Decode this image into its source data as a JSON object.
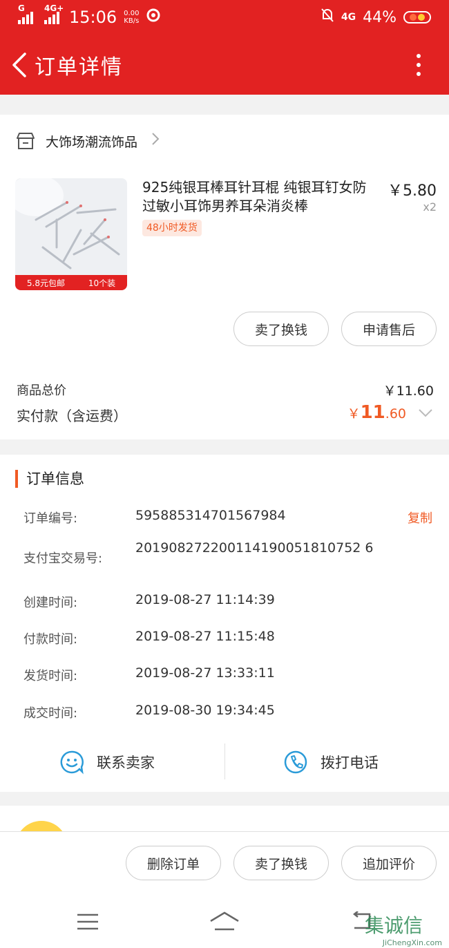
{
  "status_bar": {
    "signal1": "G",
    "signal2": "4G+",
    "time": "15:06",
    "speed_value": "0.00",
    "speed_unit": "KB/s",
    "net_right": "4G",
    "battery": "44%"
  },
  "header": {
    "title": "订单详情",
    "back_icon": "chevron-left-icon",
    "menu_icon": "more-vertical-icon"
  },
  "shop": {
    "name": "大饰场潮流饰品",
    "icon": "store-icon"
  },
  "product": {
    "title": "925纯银耳棒耳针耳棍 纯银耳钉女防过敏小耳饰男养耳朵消炎棒",
    "tag": "48小时发货",
    "price": "￥5.80",
    "quantity": "x2",
    "thumb_badge_left": "5.8元包邮",
    "thumb_badge_right": "10个装"
  },
  "item_actions": {
    "sell_label": "卖了换钱",
    "after_sale_label": "申请售后"
  },
  "totals": {
    "goods_total_label": "商品总价",
    "goods_total_value": "￥11.60",
    "paid_label": "实付款（含运费）",
    "paid_currency": "￥",
    "paid_integer": "11",
    "paid_decimal": ".60"
  },
  "order_info": {
    "section_title": "订单信息",
    "copy_label": "复制",
    "rows": [
      {
        "label": "订单编号:",
        "value": "595885314701567984"
      },
      {
        "label": "支付宝交易号:",
        "value": "201908272200114190051810752 6"
      },
      {
        "label": "创建时间:",
        "value": "2019-08-27 11:14:39"
      },
      {
        "label": "付款时间:",
        "value": "2019-08-27 11:15:48"
      },
      {
        "label": "发货时间:",
        "value": "2019-08-27 13:33:11"
      },
      {
        "label": "成交时间:",
        "value": "2019-08-30 19:34:45"
      }
    ]
  },
  "contact": {
    "seller_label": "联系卖家",
    "call_label": "拨打电话"
  },
  "bottom_actions": {
    "delete_label": "删除订单",
    "sell_label": "卖了换钱",
    "review_label": "追加评价"
  },
  "watermark": {
    "chars": "集诚信",
    "site": "JiChengXin.com"
  },
  "colors": {
    "header_red": "#e22222",
    "accent_orange": "#f05a24",
    "contact_blue": "#2b9bd8"
  }
}
